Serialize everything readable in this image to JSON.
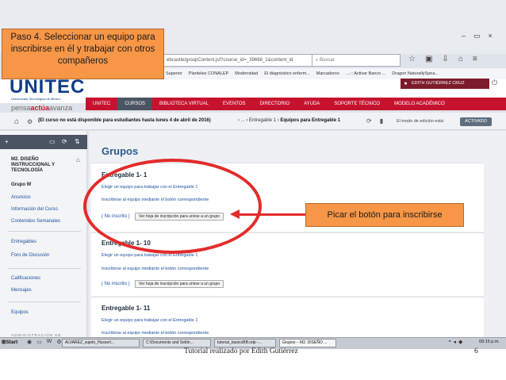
{
  "browser": {
    "url": "ebcastle/groupContent.jsf?course_id=_39666_1&content_id",
    "search_placeholder": "Buscar",
    "bookmarks": [
      "Superior",
      "Planteles CONALEP",
      "Modernidad",
      "El diagnóstico enferm...",
      "Marcadores",
      "....:: Activar Banco ...",
      "Dragon NaturallySpea..."
    ],
    "window_buttons": [
      "–",
      "▭",
      "×"
    ]
  },
  "site": {
    "logo": "UNITEC",
    "logo_sub": "Universidad Tecnológica de México",
    "pensa_logo_a": "pensa",
    "pensa_logo_b": "actúa",
    "pensa_logo_c": "avanza",
    "user_name": "EDITH GUTIÉRREZ CRUZ",
    "nav": [
      "UNITEC",
      "CURSOS",
      "BIBLIOTECA VIRTUAL",
      "EVENTOS",
      "DIRECTORIO",
      "AYUDA",
      "SOPORTE TÉCNICO",
      "MODELO ACADÉMICO"
    ],
    "nav_active": "CURSOS"
  },
  "breadcrumb": {
    "notice": "(El curso no está disponible para estudiantes hasta lunes 4 de abril de 2016)",
    "path_prefix": "› ... › Entregable 1 ›",
    "current": "Equipos para Entregable 1",
    "edit_mode_label": "El modo de edición está:",
    "edit_mode_button": "ACTIVADO"
  },
  "sidebar": {
    "course": "M2. DISEÑO INSTRUCCIONAL Y TECNOLOGÍA",
    "group_a": [
      "Grupo W",
      "Anuncios",
      "Información del Curso",
      "Contenidos Semanales"
    ],
    "group_b": [
      "Entregables",
      "Foro de Discusión"
    ],
    "group_c": [
      "Calificaciones",
      "Mensajes"
    ],
    "group_d": [
      "Equipos"
    ],
    "admin_label": "ADMINISTRACIÓN DE"
  },
  "main": {
    "title": "Grupos",
    "sections": [
      {
        "title": "Entregable 1- 1",
        "link1": "Elegir un equipo para trabajar con el Entregable 1",
        "link2": "Inscribirse al equipo mediante el botón correspondiente",
        "status": "( No inscrito )",
        "button": "Ver hoja de inscripción para unirse a un grupo"
      },
      {
        "title": "Entregable 1- 10",
        "link1": "Elegir un equipo para trabajar con el Entregable 1",
        "link2": "Inscribirse al equipo mediante el botón correspondiente",
        "status": "( No inscrito )",
        "button": "Ver hoja de inscripción para unirse a un grupo"
      },
      {
        "title": "Entregable 1- 11",
        "link1": "Elegir un equipo para trabajar con el Entregable 1",
        "link2": "Inscribirse al equipo mediante el botón correspondiente"
      }
    ]
  },
  "annotations": {
    "step": "Paso 4. Seleccionar un equipo para inscribirse en él y trabajar con otros compañeros",
    "click": "Picar el botón para inscribirse",
    "highlight_color": "#e32b2b",
    "note_color": "#f79646"
  },
  "taskbar": {
    "start": "Start",
    "buttons": [
      "ALVAREZ_sujeto_Husserl...",
      "C:\\Documents and Settin...",
      "tutorial_basicoBB.odp -...",
      "Grupos – M2. DISEÑO ..."
    ],
    "time": "09:15 p.m."
  },
  "footer": {
    "text": "Tutorial realizado por Edith Gutiérrez",
    "page": "6"
  }
}
